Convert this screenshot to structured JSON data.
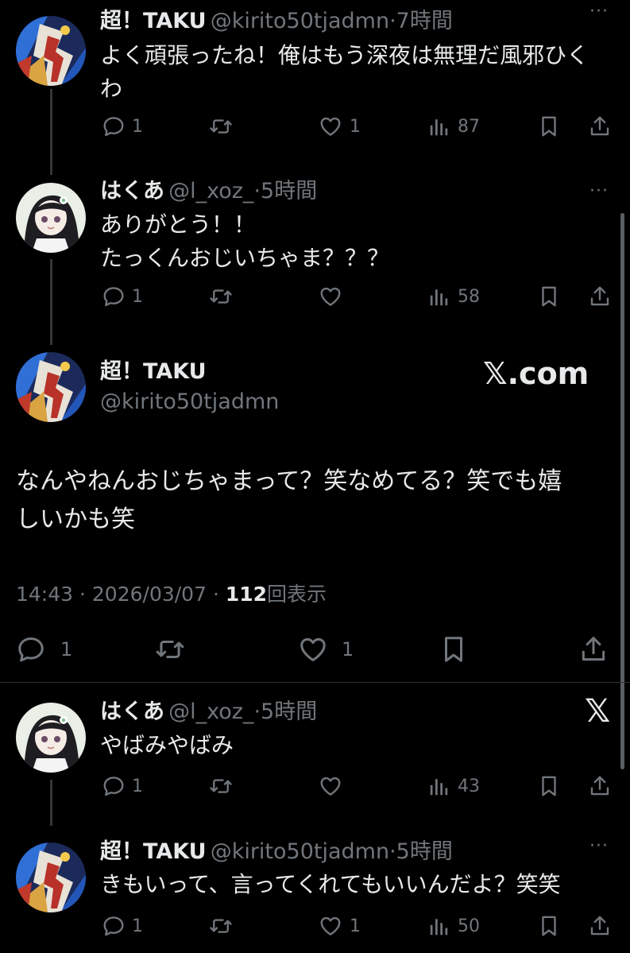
{
  "tweets": [
    {
      "name": "超！TAKU",
      "handle": "@kirito50tjadmn",
      "time": "7時間",
      "text": "よく頑張ったね！俺はもう深夜は無理だ風邪ひく\nわ",
      "replies": "1",
      "retweets": "",
      "likes": "1",
      "views": "87"
    },
    {
      "name": "はくあ",
      "handle": "@l_xoz_",
      "time": "5時間",
      "text": "ありがとう！！\nたっくんおじいちゃま？？？",
      "replies": "1",
      "retweets": "",
      "likes": "",
      "views": "58"
    }
  ],
  "main": {
    "name": "超！TAKU",
    "handle": "@kirito50tjadmn",
    "watermark": "𝕏.com",
    "text": "なんやねんおじちゃまって？笑なめてる？笑でも嬉\nしいかも笑",
    "time": "14:43",
    "date": "2026/03/07",
    "views_count": "112",
    "views_label": "回表示",
    "replies": "1",
    "retweets": "",
    "likes": "1"
  },
  "replies": [
    {
      "name": "はくあ",
      "handle": "@l_xoz_",
      "time": "5時間",
      "text": "やばみやばみ",
      "replies": "1",
      "retweets": "",
      "likes": "",
      "views": "43",
      "badge": "𝕏"
    },
    {
      "name": "超！TAKU",
      "handle": "@kirito50tjadmn",
      "time": "5時間",
      "text": "きもいって、言ってくれてもいいんだよ？笑笑",
      "replies": "1",
      "retweets": "",
      "likes": "1",
      "views": "50"
    }
  ],
  "ui": {
    "sep": "·",
    "more": "···"
  },
  "colors": {
    "background": "#000000",
    "text": "#e7e9ea",
    "muted": "#71767b",
    "line": "#333639"
  }
}
